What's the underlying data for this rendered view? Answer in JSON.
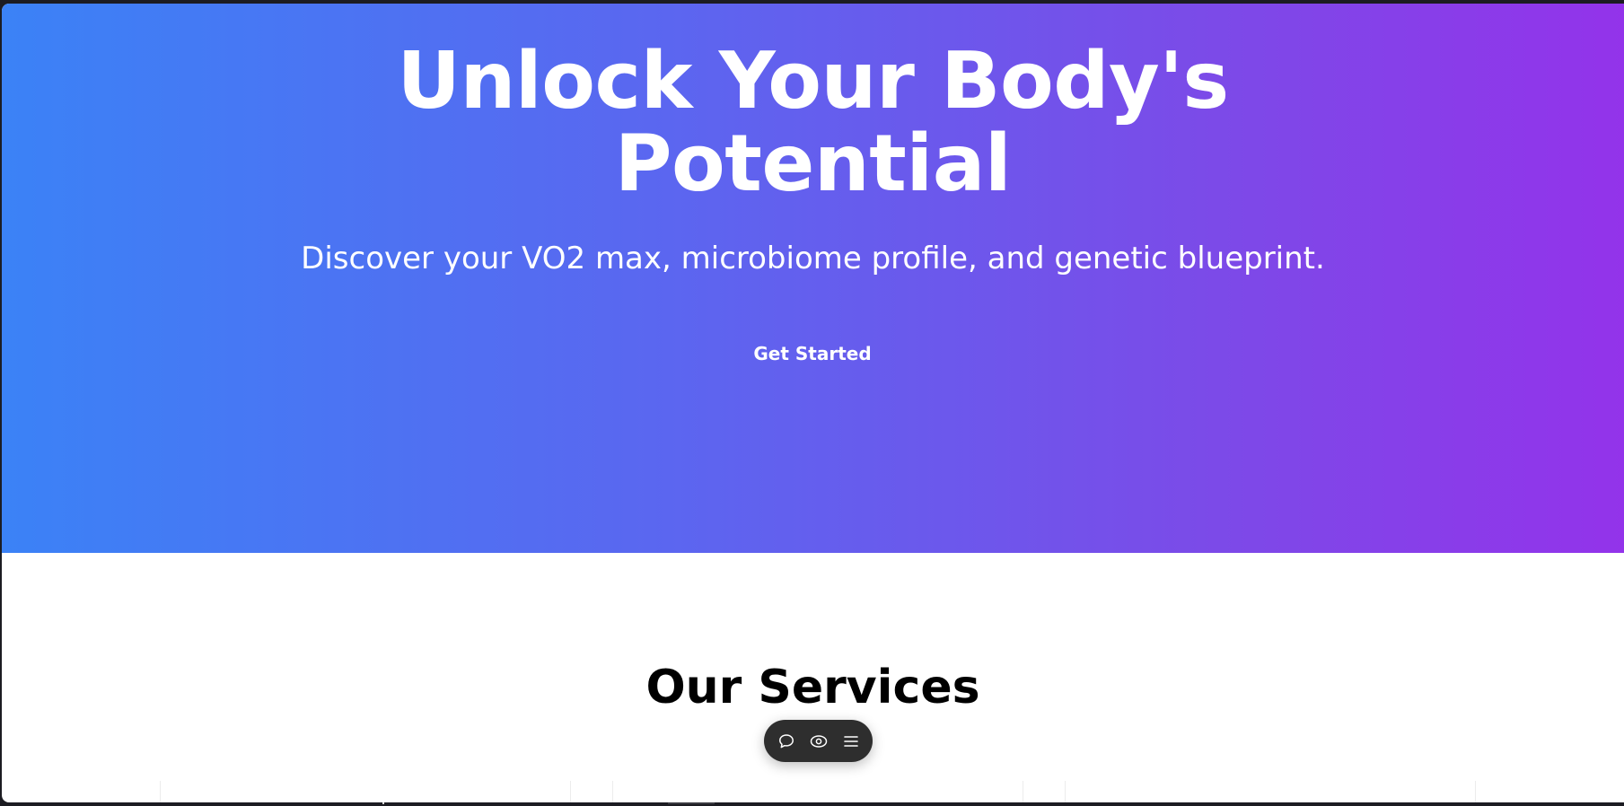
{
  "hero": {
    "title_line1": "Unlock Your Body's",
    "title_line2": "Potential",
    "subtitle": "Discover your VO2 max, microbiome profile, and genetic blueprint.",
    "cta_label": "Get Started",
    "gradient_start": "#3b82f6",
    "gradient_end": "#9333ea"
  },
  "services": {
    "title": "Our Services"
  },
  "toolbar": {
    "icons": [
      "comment-icon",
      "eye-icon",
      "menu-icon"
    ],
    "background": "#2e2e2e"
  }
}
